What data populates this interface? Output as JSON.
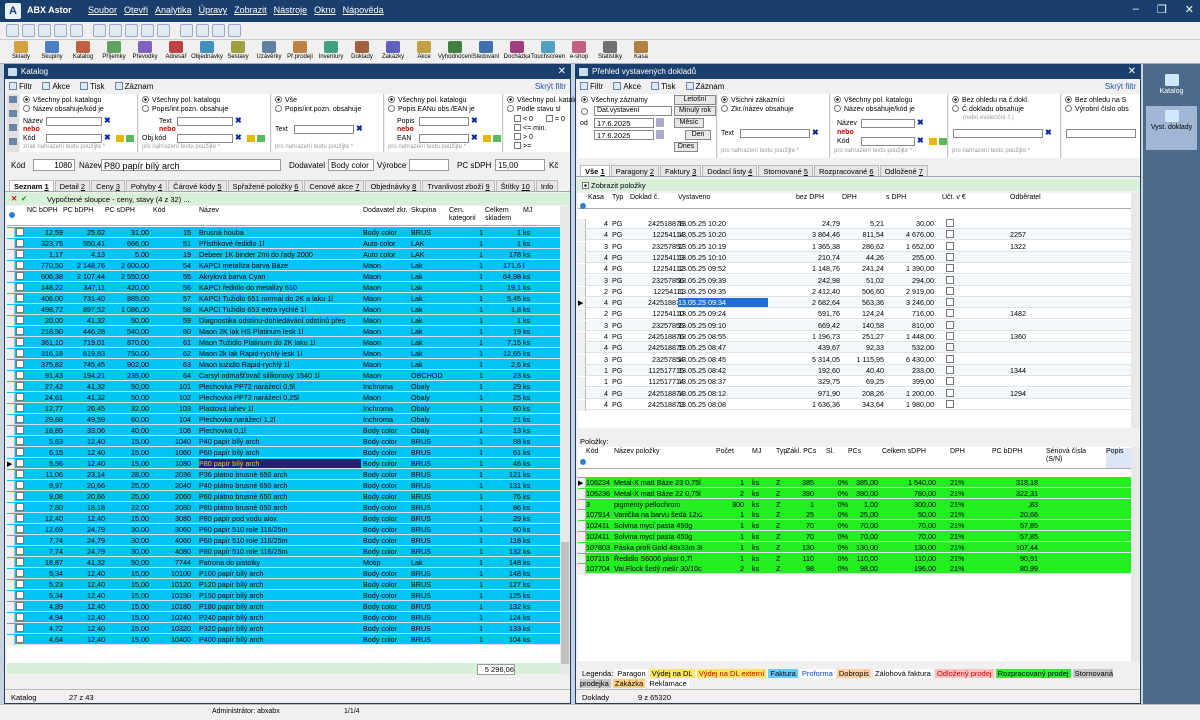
{
  "app": {
    "name": "ABX Astor",
    "menu": [
      "Soubor",
      "Otevři",
      "Analytika",
      "Úpravy",
      "Zobrazit",
      "Nástroje",
      "Okno",
      "Nápověda"
    ]
  },
  "toolbar": [
    "Sklady",
    "Skupiny",
    "Katalog",
    "Příjemky",
    "Převodky",
    "Adresář",
    "Objednávky",
    "Sestavy",
    "Uzávěrky",
    "Př.prodeji",
    "Inventury",
    "Doklady",
    "Zakázky",
    "Akce",
    "Vyhodnocení",
    "Sledování",
    "Docházka",
    "Touchscreen",
    "e-shop",
    "Statistiky",
    "Kasa"
  ],
  "right_panel": [
    {
      "label": "Katalog"
    },
    {
      "label": "Vyst. doklady"
    }
  ],
  "status": {
    "user": "Administrátor: abxabx",
    "page": "1/1/4"
  },
  "common": {
    "filter": "Filtr",
    "action": "Akce",
    "print": "Tisk",
    "record": "Záznam",
    "hide_filter": "Skrýt filtr",
    "nebo": "nebo",
    "placeholder": "pro nahrazení textu použijte *"
  },
  "catalog": {
    "title": "Katalog",
    "f1": {
      "r1": "Všechny pol. katalogu",
      "r2": "Název obsahuje/kód je",
      "l1": "Název",
      "l2": "Kód",
      "ph": "znak nahrazení textu použijte *"
    },
    "f2": {
      "r1": "Všechny pol. katalogu",
      "r2": "Popis/int.pozn. obsahuje",
      "l1": "Text",
      "l2": "Obj.kód"
    },
    "f3": {
      "r1": "Vše",
      "r2": "Popis/int.pozn. obsahuje",
      "l1": "Text"
    },
    "f4": {
      "r1": "Všechny pol. katalogu",
      "r2": "Popis EANu obs./EAN je",
      "l1": "Popis",
      "l2": "EAN"
    },
    "f5": {
      "r1": "Všechny pol. katalogu",
      "r2": "Podle stavu sl",
      "o": [
        "< 0",
        "<= min.",
        "> 0",
        ">="
      ],
      "o2": [
        "= 0"
      ]
    },
    "detail": {
      "kod_l": "Kód",
      "kod": "1080",
      "nazev_l": "Název",
      "nazev": "P80 papír bílý arch",
      "dod_l": "Dodavatel",
      "dod": "Body color",
      "vyr_l": "Výrobce",
      "pc_l": "PC sDPH",
      "pc": "15,00",
      "kc": "Kč"
    },
    "tabs": [
      {
        "label": "Seznam",
        "key": "1"
      },
      {
        "label": "Detail",
        "key": "2"
      },
      {
        "label": "Ceny",
        "key": "3"
      },
      {
        "label": "Pohyby",
        "key": "4"
      },
      {
        "label": "Čárové kódy",
        "key": "5"
      },
      {
        "label": "Spřažené položky",
        "key": "6"
      },
      {
        "label": "Cenové akce",
        "key": "7"
      },
      {
        "label": "Objednávky",
        "key": "8"
      },
      {
        "label": "Trvanlivost zboží",
        "key": "9"
      },
      {
        "label": "Štítky",
        "key": "10"
      },
      {
        "label": "Info",
        "key": ""
      }
    ],
    "computed": "Vypočtené sloupce - ceny, stavy (4 z 32) ...",
    "cols": [
      "NC bDPH",
      "PC bDPH",
      "PC sDPH",
      "Kód",
      "Název",
      "Dodavatel zkr.",
      "Skupina",
      "Cen. kategorií",
      "Celkem skladem",
      "MJ"
    ],
    "rows": [
      [
        "12,59",
        "25,62",
        "31,00",
        "15",
        "Brusná houba",
        "Body color",
        "BRUS",
        "1",
        "1",
        "ks"
      ],
      [
        "323,75",
        "550,41",
        "666,00",
        "51",
        "Přísthkové ředidlo 1l",
        "Auto color",
        "LAK",
        "1",
        "1",
        "ks"
      ],
      [
        "1,17",
        "4,13",
        "5,00",
        "19",
        "Debeer 1K binder 2ml do řady 2000",
        "Auto color",
        "LAK",
        "1",
        "178",
        "ks"
      ],
      [
        "770,50",
        "2 148,76",
        "2 600,00",
        "54",
        "KAPCI metalíza barva Báze",
        "Maon",
        "Lak",
        "1",
        "171,6",
        "l"
      ],
      [
        "606,38",
        "2 107,44",
        "2 550,00",
        "55",
        "Akrylová barva Cyan",
        "Maon",
        "Lak",
        "1",
        "64,98",
        "ks"
      ],
      [
        "148,22",
        "347,11",
        "420,00",
        "56",
        "KAPCI ředidlo do metalízy 610",
        "Maon",
        "Lak",
        "1",
        "19,1",
        "ks"
      ],
      [
        "406,00",
        "731,40",
        "885,00",
        "57",
        "KAPCI Tužidlo 651 normal do 2K a laku 1l",
        "Maon",
        "Lak",
        "1",
        "5,45",
        "ks"
      ],
      [
        "498,72",
        "897,52",
        "1 086,00",
        "58",
        "KAPCI Tužidlo 653 extra rychlé 1l",
        "Maon",
        "Lak",
        "1",
        "1,8",
        "ks"
      ],
      [
        "20,00",
        "41,32",
        "50,00",
        "59",
        "Diagnostika odstínu-dohledávání odstínů přes",
        "Maon",
        "Lak",
        "1",
        "1",
        "ks"
      ],
      [
        "218,50",
        "446,28",
        "540,00",
        "60",
        "Maon 2K lak HS Platinum lesk 1l",
        "Maon",
        "Lak",
        "1",
        "19",
        "ks"
      ],
      [
        "361,10",
        "719,01",
        "870,00",
        "61",
        "Maon Tužidlo Platinum do 2K laku 1l",
        "Maon",
        "Lak",
        "1",
        "7,15",
        "ks"
      ],
      [
        "316,18",
        "619,83",
        "750,00",
        "62",
        "Maon 2k lak Rapid-rychlý lesk 1l",
        "Maon",
        "Lak",
        "1",
        "12,65",
        "ks"
      ],
      [
        "375,82",
        "745,45",
        "902,00",
        "63",
        "Maon tužidlo Rapid-rychlý 1l",
        "Maon",
        "Lak",
        "1",
        "2,6",
        "ks"
      ],
      [
        "91,43",
        "194,21",
        "235,00",
        "64",
        "Carsyl odmašťovač silikonový 1540 1l",
        "Maon",
        "OBCHOD",
        "1",
        "23",
        "ks"
      ],
      [
        "27,42",
        "41,32",
        "50,00",
        "101",
        "Plechovka PP72 narážecí 0,5l",
        "Inchroma",
        "Obaly",
        "1",
        "29",
        "ks"
      ],
      [
        "24,61",
        "41,32",
        "50,00",
        "102",
        "Plechovka PP72 narážecí 0,25l",
        "Maon",
        "Obaly",
        "1",
        "25",
        "ks"
      ],
      [
        "12,77",
        "26,45",
        "32,00",
        "103",
        "Plastová lahev 1l",
        "Inchroma",
        "Obaly",
        "1",
        "60",
        "ks"
      ],
      [
        "29,68",
        "49,59",
        "60,00",
        "104",
        "Plechovka narážecí 1,2l",
        "Inchroma",
        "Obaly",
        "1",
        "21",
        "ks"
      ],
      [
        "18,85",
        "33,06",
        "40,00",
        "108",
        "Plechovka 0,1l",
        "Body color",
        "Obaly",
        "1",
        "13",
        "ks"
      ],
      [
        "5,63",
        "12,40",
        "15,00",
        "1040",
        "P40 papír bílý arch",
        "Body color",
        "BRUS",
        "1",
        "88",
        "ks"
      ],
      [
        "6,15",
        "12,40",
        "15,00",
        "1060",
        "P60 papír bílý arch",
        "Body color",
        "BRUS",
        "1",
        "61",
        "ks"
      ],
      [
        "5,56",
        "12,40",
        "15,00",
        "1080",
        "P80 papír bílý arch",
        "Body color",
        "BRUS",
        "1",
        "46",
        "ks"
      ],
      [
        "11,06",
        "23,14",
        "28,00",
        "2036",
        "P36 plátno brusné 650 arch",
        "Body color",
        "BRUS",
        "1",
        "121",
        "ks"
      ],
      [
        "9,97",
        "20,66",
        "25,00",
        "2040",
        "P40 plátno brusné 650 arch",
        "Body color",
        "BRUS",
        "1",
        "131",
        "ks"
      ],
      [
        "9,08",
        "20,66",
        "25,00",
        "2060",
        "P60 plátno brusné 650 arch",
        "Body color",
        "BRUS",
        "1",
        "76",
        "ks"
      ],
      [
        "7,80",
        "18,18",
        "22,00",
        "2080",
        "P80 plátno brusné 650 arch",
        "Body color",
        "BRUS",
        "1",
        "86",
        "ks"
      ],
      [
        "12,40",
        "12,40",
        "15,00",
        "3080",
        "P80 papír pod vodu alox",
        "Body color",
        "BRUS",
        "1",
        "29",
        "ks"
      ],
      [
        "12,69",
        "24,79",
        "30,00",
        "3060",
        "P60 papír 510 role 116/25m",
        "Body color",
        "BRUS",
        "1",
        "60",
        "ks"
      ],
      [
        "7,74",
        "24,79",
        "30,00",
        "4060",
        "P60 papír 510 role 116/25m",
        "Body color",
        "BRUS",
        "1",
        "118",
        "ks"
      ],
      [
        "7,74",
        "24,79",
        "30,00",
        "4080",
        "P80 papír 510 role 116/25m",
        "Body color",
        "BRUS",
        "1",
        "132",
        "ks"
      ],
      [
        "18,87",
        "41,32",
        "50,00",
        "7744",
        "Patrona do pistolky",
        "Motip",
        "Lak",
        "1",
        "148",
        "ks"
      ],
      [
        "5,34",
        "12,40",
        "15,00",
        "10100",
        "P100 papír bílý arch",
        "Body color",
        "BRUS",
        "1",
        "148",
        "ks"
      ],
      [
        "5,23",
        "12,40",
        "15,00",
        "10120",
        "P120 papír bílý arch",
        "Body color",
        "BRUS",
        "1",
        "127",
        "ks"
      ],
      [
        "5,34",
        "12,40",
        "15,00",
        "10150",
        "P150 papír bílý arch",
        "Body color",
        "BRUS",
        "1",
        "125",
        "ks"
      ],
      [
        "4,89",
        "12,40",
        "15,00",
        "10180",
        "P180 papír bílý arch",
        "Body color",
        "BRUS",
        "1",
        "132",
        "ks"
      ],
      [
        "4,94",
        "12,40",
        "15,00",
        "10240",
        "P240 papír bílý arch",
        "Body color",
        "BRUS",
        "1",
        "124",
        "ks"
      ],
      [
        "4,72",
        "12,40",
        "15,00",
        "10320",
        "P320 papír bílý arch",
        "Body color",
        "BRUS",
        "1",
        "133",
        "ks"
      ],
      [
        "4,64",
        "12,40",
        "15,00",
        "10400",
        "P400 papír bílý arch",
        "Body color",
        "BRUS",
        "1",
        "104",
        "ks"
      ]
    ],
    "total": "5 296,06",
    "status": {
      "left": "Katalog",
      "right": "27 z 43"
    }
  },
  "docs": {
    "title": "Přehled vystavených dokladů",
    "f1": {
      "r1": "Všechny záznamy",
      "sel": "Dat.vystavení",
      "d1": "17.6.2025",
      "d2": "17.6.2025",
      "b1": "Letošní",
      "b2": "Minulý rok",
      "b3": "Měsíc",
      "b4": "Den",
      "b5": "Dnes"
    },
    "f2": {
      "r1": "Všichni zákazníci",
      "r2": "Zkr./název obsahuje",
      "l1": "Text"
    },
    "f3": {
      "r1": "Všechny pol. katalogu",
      "r2": "Název obsahuje/kód je",
      "l1": "Název",
      "l2": "Kód"
    },
    "f4": {
      "r1": "Bez ohledu na č.dokl.",
      "r2": "Č.dokladu obsahuje",
      "ph": "(nebo evidenční č.)"
    },
    "f5": {
      "r1": "Bez ohledu na S",
      "r2": "Výrobní číslo obs"
    },
    "tabs": [
      {
        "label": "Vše",
        "key": "1"
      },
      {
        "label": "Paragony",
        "key": "2"
      },
      {
        "label": "Faktury",
        "key": "3"
      },
      {
        "label": "Dodací listy",
        "key": "4"
      },
      {
        "label": "Stornované",
        "key": "5"
      },
      {
        "label": "Rozpracované",
        "key": "6"
      },
      {
        "label": "Odložené",
        "key": "7"
      }
    ],
    "show_items": "Zobrazit položky",
    "cols": [
      "Kasa",
      "Typ",
      "Doklad č.",
      "Vystaveno",
      "bez DPH",
      "DPH",
      "s DPH",
      "Účt. v €",
      "Odběratel"
    ],
    "rows": [
      [
        "4",
        "PG",
        "242518878",
        "13.05.25 10:20",
        "24,79",
        "5,21",
        "30,00",
        ""
      ],
      [
        "4",
        "PG",
        "12254114",
        "13.05.25 10:20",
        "3 864,46",
        "811,54",
        "4 676,00",
        "2257"
      ],
      [
        "3",
        "PG",
        "23257857",
        "13.05.25 10:19",
        "1 365,38",
        "286,62",
        "1 652,00",
        "1322"
      ],
      [
        "4",
        "PG",
        "12254113",
        "13.05.25 10:10",
        "210,74",
        "44,26",
        "255,00",
        ""
      ],
      [
        "4",
        "PG",
        "12254112",
        "13.05.25 09:52",
        "1 148,76",
        "241,24",
        "1 390,00",
        ""
      ],
      [
        "3",
        "PG",
        "23257856",
        "13.05.25 09:39",
        "242,98",
        "51,02",
        "294,00",
        ""
      ],
      [
        "2",
        "PG",
        "12254111",
        "13.05.25 09:35",
        "2 412,40",
        "506,60",
        "2 919,00",
        ""
      ],
      [
        "4",
        "PG",
        "242518877",
        "13.05.25 09:34",
        "2 682,64",
        "563,36",
        "3 246,00",
        ""
      ],
      [
        "2",
        "PG",
        "12254110",
        "13.05.25 09:24",
        "591,76",
        "124,24",
        "716,00",
        "1482"
      ],
      [
        "3",
        "PG",
        "23257855",
        "13.05.25 09:10",
        "669,42",
        "140,58",
        "810,00",
        ""
      ],
      [
        "4",
        "PG",
        "242518876",
        "13.05.25 08:55",
        "1 196,73",
        "251,27",
        "1 448,00",
        "1360"
      ],
      [
        "4",
        "PG",
        "242518875",
        "13.05.25 08:47",
        "439,67",
        "92,33",
        "532,00",
        ""
      ],
      [
        "3",
        "PG",
        "23257854",
        "13.05.25 08:45",
        "5 314,05",
        "1 115,95",
        "6 430,00",
        ""
      ],
      [
        "1",
        "PG",
        "112517715",
        "13.05.25 08:42",
        "192,60",
        "40,40",
        "233,00",
        "1344"
      ],
      [
        "1",
        "PG",
        "112517714",
        "13.05.25 08:37",
        "329,75",
        "69,25",
        "399,00",
        ""
      ],
      [
        "4",
        "PG",
        "242518874",
        "13.05.25 08:12",
        "971,90",
        "208,26",
        "1 200,00",
        "1294"
      ],
      [
        "4",
        "PG",
        "242518873",
        "13.05.25 08:08",
        "1 636,36",
        "343,64",
        "1 980,00",
        ""
      ]
    ],
    "items_label": "Položky:",
    "icols": [
      "Kód",
      "Název položky",
      "Počet",
      "MJ",
      "Typ",
      "Zákl. PCs",
      "Sl.",
      "PCs",
      "Celkem sDPH",
      "DPH",
      "PC bDPH",
      "Sériová čísla (S/N)",
      "Popis"
    ],
    "items": [
      [
        "106234",
        "Metal-X matt Báze 23 0,75l",
        "1",
        "ks",
        "Z",
        "385",
        "0%",
        "385,00",
        "1 540,00",
        "21%",
        "318,18"
      ],
      [
        "106236",
        "Metal-X matt Báze 22 0,75l",
        "2",
        "ks",
        "Z",
        "390",
        "0%",
        "390,00",
        "780,00",
        "21%",
        "322,31"
      ],
      [
        "3",
        "pigmenty pellochrom",
        "300",
        "ks",
        "Z",
        "1",
        "0%",
        "1,00",
        "300,00",
        "21%",
        ",83"
      ],
      [
        "107914",
        "Vanička na barvu šedá 12x25cm",
        "1",
        "ks",
        "Z",
        "25",
        "0%",
        "25,00",
        "50,00",
        "21%",
        "20,66"
      ],
      [
        "102411",
        "Solvina mycí pasta 450g",
        "1",
        "ks",
        "Z",
        "70",
        "0%",
        "70,00",
        "70,00",
        "21%",
        "57,85"
      ],
      [
        "102411",
        "Solvina mycí pasta 450g",
        "1",
        "ks",
        "Z",
        "70",
        "0%",
        "70,00",
        "70,00",
        "21%",
        "57,85"
      ],
      [
        "107803",
        "Páska profi Gold 48x33m 300",
        "1",
        "ks",
        "Z",
        "130",
        "0%",
        "130,00",
        "130,00",
        "21%",
        "107,44"
      ],
      [
        "107116",
        "Ředidlo S6006 plast 0,7l",
        "1",
        "ks",
        "Z",
        "110",
        "0%",
        "110,00",
        "110,00",
        "21%",
        "90,91"
      ],
      [
        "107704",
        "Vai.Flock šedý melír 30/10cm",
        "2",
        "ks",
        "Z",
        "98",
        "0%",
        "98,00",
        "196,00",
        "21%",
        "80,99"
      ]
    ],
    "legend_label": "Legenda:",
    "legend": [
      {
        "t": "Paragon",
        "bg": "#ffffff",
        "fg": "#000"
      },
      {
        "t": "Výdej na DL",
        "bg": "#ffe566",
        "fg": "#000"
      },
      {
        "t": "Výdej na DL externí",
        "bg": "#ffe566",
        "fg": "#c00"
      },
      {
        "t": "Faktura",
        "bg": "#66ccff",
        "fg": "#000"
      },
      {
        "t": "Proforma",
        "bg": "#ffffff",
        "fg": "#0044cc"
      },
      {
        "t": "Dobropis",
        "bg": "#ffd0a0",
        "fg": "#000"
      },
      {
        "t": "Zálohová faktura",
        "bg": "#ffffff",
        "fg": "#000"
      },
      {
        "t": "Odložený prodej",
        "bg": "#ffc0c0",
        "fg": "#c00"
      },
      {
        "t": "Rozpracovaný prodej",
        "bg": "#33ee33",
        "fg": "#000"
      },
      {
        "t": "Stornovaná prodejka",
        "bg": "#c8c8c8",
        "fg": "#000"
      },
      {
        "t": "Zakázka",
        "bg": "#ffd080",
        "fg": "#000"
      },
      {
        "t": "Reklamace",
        "bg": "#ffffff",
        "fg": "#000"
      }
    ],
    "status": {
      "left": "Doklady",
      "right": "9 z 65320"
    }
  },
  "colors": {
    "cyan": "#00c4f2",
    "green": "#22ee22",
    "navy": "#1b3f6c",
    "sel": "#1a237e"
  }
}
